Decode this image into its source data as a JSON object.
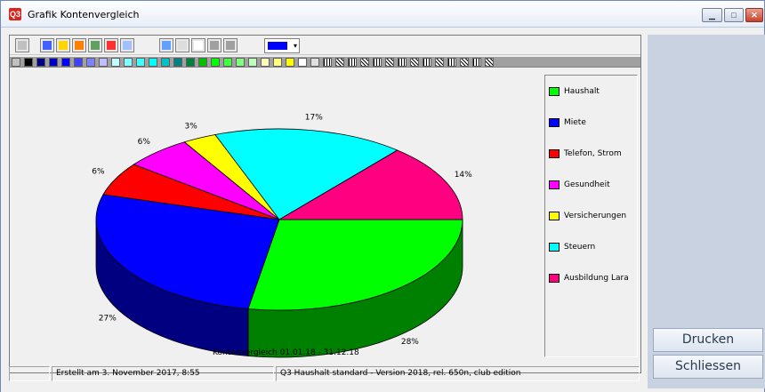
{
  "window": {
    "title": "Grafik Kontenvergleich"
  },
  "colors": {
    "titlebar": "#e8eef8",
    "sidepanel": "#c8d2e0"
  },
  "toolbar": {
    "icons": [
      "camera-icon",
      "area-chart-icon",
      "hbar-chart-icon",
      "bar-chart-icon",
      "line-chart-icon",
      "pie-chart-icon",
      "scatter-chart-icon",
      "3d-toggle-icon",
      "grid-icon",
      "document-icon",
      "blank-a-icon",
      "blank-b-icon"
    ],
    "selected_color": "#0000ff"
  },
  "palette": [
    "#c0c0c0",
    "#000000",
    "#000080",
    "#0000c0",
    "#0000ff",
    "#4040ff",
    "#8080ff",
    "#c0c0ff",
    "#c0ffff",
    "#80ffff",
    "#40ffff",
    "#00ffff",
    "#00c0c0",
    "#008080",
    "#008040",
    "#00c000",
    "#00ff00",
    "#40ff40",
    "#80ff80",
    "#c0ffc0",
    "#ffffc0",
    "#ffff80",
    "#ffff00",
    "#ffffff",
    "#e0e0e0"
  ],
  "chart_data": {
    "type": "pie",
    "three_d": true,
    "slices": [
      {
        "label": "Haushalt",
        "value": 28,
        "color": "#00ff00",
        "side": "#008000"
      },
      {
        "label": "Miete",
        "value": 27,
        "color": "#0000ff",
        "side": "#000080"
      },
      {
        "label": "Telefon, Strom",
        "value": 6,
        "color": "#ff0000",
        "side": "#800000"
      },
      {
        "label": "Gesundheit",
        "value": 6,
        "color": "#ff00ff",
        "side": "#800080"
      },
      {
        "label": "Versicherungen",
        "value": 3,
        "color": "#ffff00",
        "side": "#808000"
      },
      {
        "label": "Steuern",
        "value": 17,
        "color": "#00ffff",
        "side": "#008080"
      },
      {
        "label": "Ausbildung Lara",
        "value": 14,
        "color": "#ff0080",
        "side": "#800040"
      }
    ],
    "percent_labels": [
      "28%",
      "27%",
      "6%",
      "6%",
      "3%",
      "17%",
      "14%"
    ],
    "title": "Kontenvergleich   01.01.18 - 31.12.18",
    "legend_position": "right"
  },
  "buttons": {
    "print": "Drucken",
    "close": "Schliessen"
  },
  "status": {
    "created": "Erstellt am 3. November 2017,  8:55",
    "version": "Q3 Haushalt standard - Version 2018, rel. 650n, club edition"
  }
}
